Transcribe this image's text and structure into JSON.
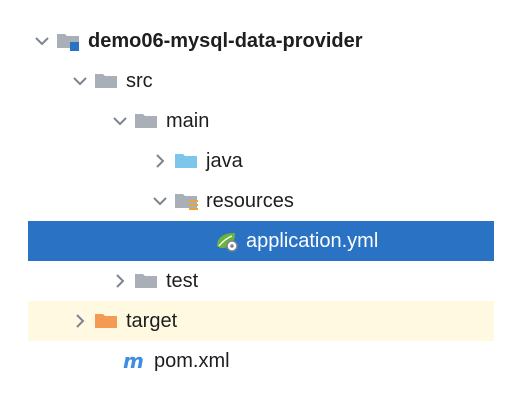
{
  "project_tree": {
    "root": {
      "label": "demo06-mysql-data-provider",
      "expanded": true
    },
    "src": {
      "label": "src",
      "expanded": true
    },
    "main": {
      "label": "main",
      "expanded": true
    },
    "java": {
      "label": "java",
      "expanded": false
    },
    "resources": {
      "label": "resources",
      "expanded": true
    },
    "application_yml": {
      "label": "application.yml",
      "selected": true
    },
    "test": {
      "label": "test",
      "expanded": false
    },
    "target": {
      "label": "target",
      "expanded": false
    },
    "pom": {
      "label": "pom.xml"
    }
  },
  "colors": {
    "selection": "#2a72c4",
    "target_row": "#fff9e1",
    "folder_gray": "#a9afb6",
    "source_folder_blue": "#7cc6ec",
    "excluded_folder_orange": "#f39a53",
    "maven_blue": "#3b8ee0"
  },
  "icons": {
    "expanded": "chevron-down-icon",
    "collapsed": "chevron-right-icon",
    "module": "module-folder-icon",
    "folder": "folder-icon",
    "source_folder": "source-folder-icon",
    "resources_folder": "resources-folder-icon",
    "excluded_folder": "excluded-folder-icon",
    "spring_yaml": "spring-config-icon",
    "maven": "maven-icon"
  }
}
